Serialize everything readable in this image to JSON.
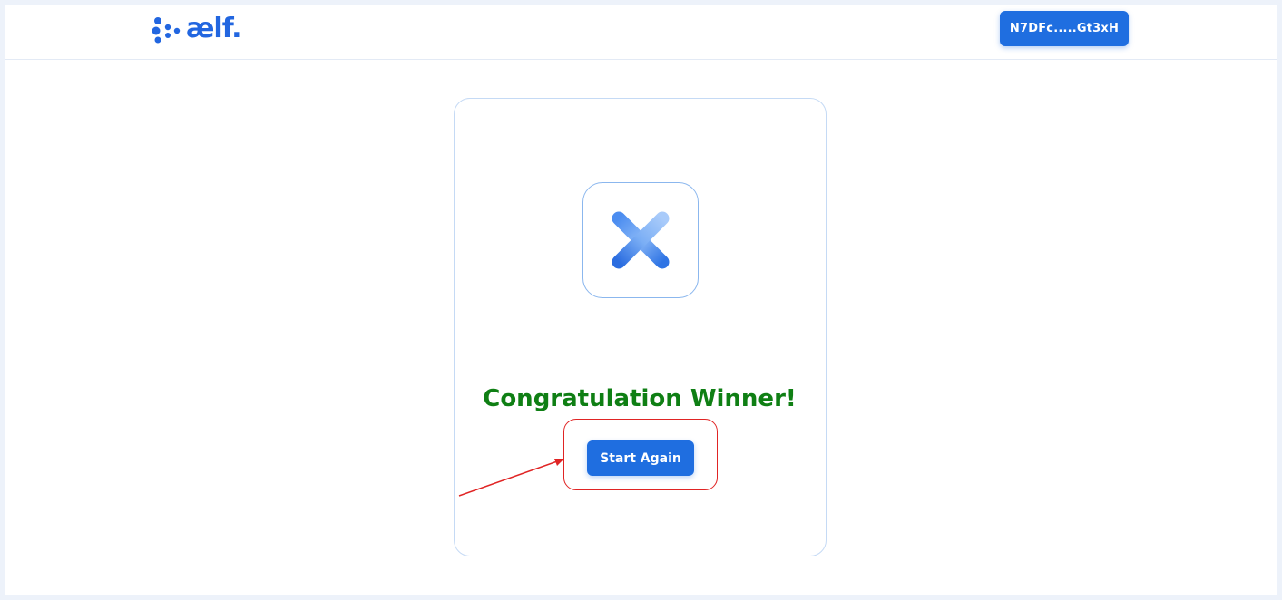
{
  "header": {
    "logo_text": "ælf.",
    "wallet_address": "N7DFc.....Gt3xH"
  },
  "result": {
    "status_icon": "close-icon",
    "title": "Congratulation Winner!",
    "start_again_label": "Start Again"
  },
  "colors": {
    "primary": "#1f6ee0",
    "winner_text": "#0f7f14",
    "card_border": "#c5daf5",
    "annotation": "#e02424"
  }
}
